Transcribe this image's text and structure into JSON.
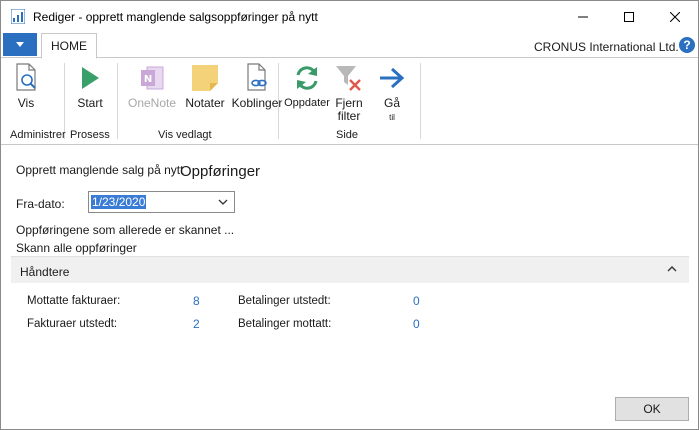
{
  "window": {
    "title": "Rediger - opprett manglende salgsoppføringer på nytt"
  },
  "ribbon": {
    "tab_home": "HOME",
    "company": "CRONUS International Ltd.",
    "help_icon": "question-circle-icon",
    "buttons": {
      "vis": "Vis",
      "start": "Start",
      "onenote": "OneNote",
      "notater": "Notater",
      "koblinger": "Koblinger",
      "oppdater": "Oppdater",
      "fjern_filter_1": "Fjern",
      "fjern_filter_2": "filter",
      "ga_1": "Gå",
      "ga_2": "til"
    },
    "groups": {
      "administrer": "Administrer",
      "prosess": "Prosess",
      "vis_vedlagt": "Vis vedlagt",
      "side": "Side"
    }
  },
  "page": {
    "subtitle": "Opprett manglende salg på nytt",
    "title": "Oppføringer",
    "fra_dato_label": "Fra-dato:",
    "fra_dato_value": "1/23/2020",
    "info_line1": "Oppføringene som allerede er skannet ...",
    "info_line2": "Skann alle oppføringer"
  },
  "fasttab": {
    "title": "Håndtere",
    "fields": {
      "mottatte_fakturaer_label": "Mottatte fakturaer:",
      "mottatte_fakturaer_value": "8",
      "fakturaer_utstedt_label": "Fakturaer utstedt:",
      "fakturaer_utstedt_value": "2",
      "betalinger_utstedt_label": "Betalinger utstedt:",
      "betalinger_utstedt_value": "0",
      "betalinger_mottatt_label": "Betalinger mottatt:",
      "betalinger_mottatt_value": "0"
    }
  },
  "footer": {
    "ok": "OK"
  },
  "colors": {
    "accent": "#2a6fc0",
    "link_value": "#2a6fc0",
    "start_green": "#3aa06a",
    "onenote_purple": "#c9a8d8",
    "notes_yellow": "#f3d27a",
    "refresh_green": "#3a9a6a",
    "arrow_blue": "#2a6fc0"
  }
}
